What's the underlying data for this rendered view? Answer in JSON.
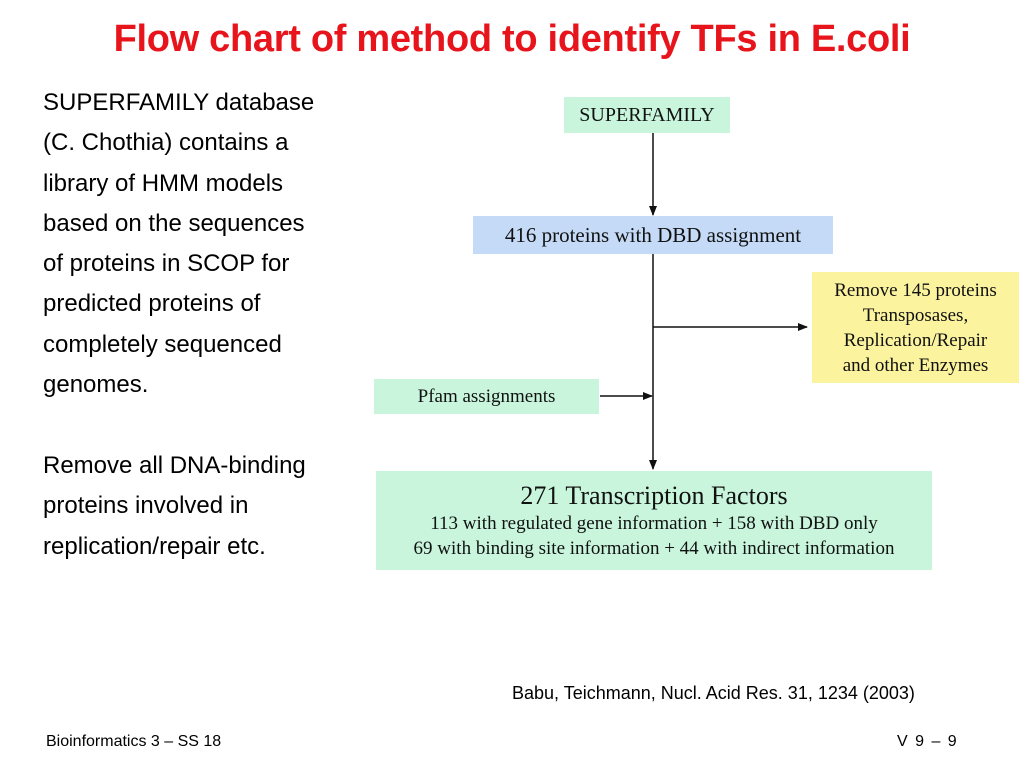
{
  "slide": {
    "title": "Flow chart of method to identify TFs in E.coli",
    "description_1": [
      "SUPERFAMILY database",
      "(C. Chothia) contains a",
      "library of HMM models",
      "based on the sequences",
      "of proteins in SCOP for",
      "predicted proteins of",
      "completely sequenced",
      "genomes."
    ],
    "description_2": [
      "Remove all DNA-binding",
      "proteins involved in",
      "replication/repair etc."
    ],
    "citation": "Babu, Teichmann, Nucl. Acid Res. 31, 1234 (2003)",
    "footer_left": "Bioinformatics 3 – SS 18",
    "footer_right": "V 9 – 9"
  },
  "flowchart": {
    "nodes": {
      "superfamily": {
        "label": "SUPERFAMILY",
        "color": "#c8f5dc"
      },
      "dbd": {
        "label": "416 proteins with DBD assignment",
        "color": "#c4daf6"
      },
      "remove": {
        "lines": [
          "Remove 145 proteins",
          "Transposases,",
          "Replication/Repair",
          "and other Enzymes"
        ],
        "color": "#fbf39e"
      },
      "pfam": {
        "label": "Pfam assignments",
        "color": "#c8f5dc"
      },
      "tf": {
        "title": "271 Transcription Factors",
        "lines": [
          "113 with regulated gene information + 158 with DBD only",
          "69 with binding site information + 44 with indirect information"
        ],
        "color": "#c8f5dc"
      }
    },
    "edges": [
      {
        "from": "superfamily",
        "to": "dbd"
      },
      {
        "from": "dbd",
        "to": "remove"
      },
      {
        "from": "pfam",
        "to": "tf"
      },
      {
        "from": "dbd",
        "to": "tf"
      }
    ]
  },
  "colors": {
    "title": "#e8141c",
    "text": "#000000"
  }
}
